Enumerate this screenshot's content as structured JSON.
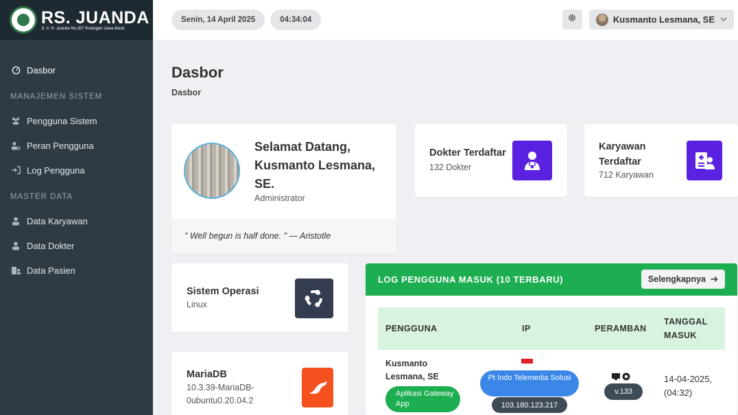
{
  "brand": {
    "name": "RS. JUANDA",
    "address": "Jl. Ir. H. Juanda No.207 Kuningan Jawa Barat"
  },
  "topbar": {
    "date": "Senin, 14 April 2025",
    "time": "04:34:04",
    "user_name": "Kusmanto Lesmana, SE"
  },
  "sidebar": {
    "dashboard": "Dasbor",
    "section_system": "MANAJEMEN SISTEM",
    "system_items": [
      "Pengguna Sistem",
      "Peran Pengguna",
      "Log Pengguna"
    ],
    "section_master": "MASTER DATA",
    "master_items": [
      "Data Karyawan",
      "Data Dokter",
      "Data Pasien"
    ]
  },
  "page": {
    "title": "Dasbor",
    "breadcrumb": "Dasbor"
  },
  "welcome": {
    "greeting": "Selamat Datang, Kusmanto Lesmana, SE.",
    "role": "Administrator",
    "quote": "\" Well begun is half done. \" — Aristotle"
  },
  "stats": {
    "doctors": {
      "title": "Dokter Terdaftar",
      "sub": "132 Dokter",
      "icon": "doctor-icon",
      "color": "#5b21e0"
    },
    "employees": {
      "title": "Karyawan Terdaftar",
      "sub": "712 Karyawan",
      "icon": "employee-icon",
      "color": "#5b21e0"
    },
    "os": {
      "title": "Sistem Operasi",
      "sub": "Linux",
      "icon": "ubuntu-icon",
      "color": "#333d4f"
    },
    "db": {
      "title": "MariaDB",
      "sub": "10.3.39-MariaDB-0ubuntu0.20.04.2",
      "icon": "mariadb-icon",
      "color": "#f4511e"
    }
  },
  "log": {
    "title": "LOG PENGGUNA MASUK (10 TERBARU)",
    "more": "Selengkapnya",
    "columns": [
      "PENGGUNA",
      "IP",
      "PERAMBAN",
      "TANGGAL MASUK"
    ],
    "rows": [
      {
        "user": "Kusmanto Lesmana, SE",
        "app": "Aplikasi Gateway App",
        "isp": "Pt Indo Telemedia Solusi",
        "ip": "103.180.123.217",
        "browser_version": "v.133",
        "date": "14-04-2025, (04:32)"
      }
    ]
  },
  "colors": {
    "sidebar": "#2f3b44",
    "accent_green": "#1eae52",
    "accent_purple": "#5b21e0",
    "accent_blue": "#3a87e8"
  }
}
